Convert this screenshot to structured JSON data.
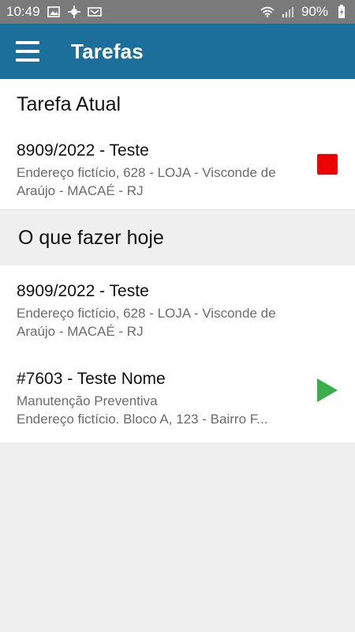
{
  "statusbar": {
    "time": "10:49",
    "battery": "90%",
    "icons": [
      "image-icon",
      "gps-icon",
      "notification-icon",
      "wifi-icon",
      "signal-icon",
      "battery-charging-icon"
    ]
  },
  "appbar": {
    "title": "Tarefas",
    "menu_icon": "hamburger-menu-icon"
  },
  "current_section": {
    "header": "Tarefa Atual",
    "task": {
      "title": "8909/2022 - Teste",
      "lines": [
        "Endereço fictício, 628 - LOJA - Visconde de Araújo - MACAÉ - RJ"
      ],
      "action": "stop",
      "action_color": "#ee0000"
    }
  },
  "today_section": {
    "header": "O que fazer hoje",
    "tasks": [
      {
        "title": "8909/2022 - Teste",
        "lines": [
          "Endereço fictício, 628 - LOJA - Visconde de Araújo - MACAÉ - RJ"
        ]
      },
      {
        "title": "#7603 - Teste Nome",
        "lines": [
          "Manutenção Preventiva",
          "Endereço fictício. Bloco A, 123 - Bairro F..."
        ],
        "action": "play",
        "action_color": "#3cae49"
      }
    ]
  },
  "colors": {
    "appbar": "#1b6f9a",
    "statusbar": "#7a7a7a",
    "background": "#efefef"
  }
}
